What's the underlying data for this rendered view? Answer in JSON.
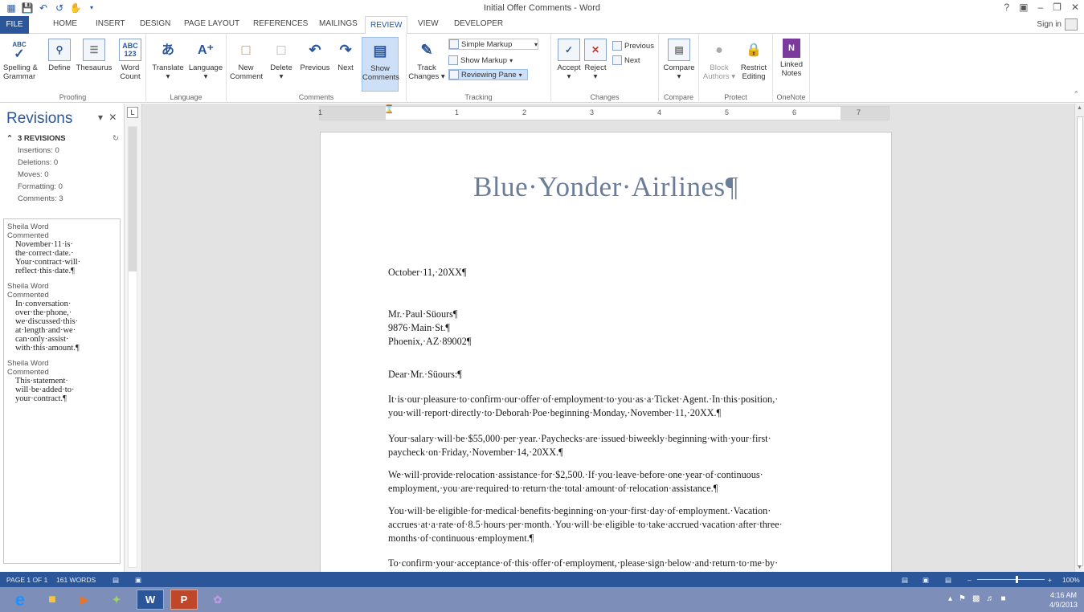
{
  "titlebar": {
    "title": "Initial Offer Comments - Word",
    "controls": [
      "?",
      "▣",
      "–",
      "❐",
      "✕"
    ]
  },
  "tabs": {
    "file": "FILE",
    "items": [
      "HOME",
      "INSERT",
      "DESIGN",
      "PAGE LAYOUT",
      "REFERENCES",
      "MAILINGS",
      "REVIEW",
      "VIEW",
      "DEVELOPER"
    ],
    "active": "REVIEW",
    "sign_in": "Sign in"
  },
  "ribbon": {
    "proofing": {
      "label": "Proofing",
      "spelling": "Spelling &",
      "spelling2": "Grammar",
      "define": "Define",
      "thesaurus": "Thesaurus",
      "wordcount": "Word",
      "wordcount2": "Count",
      "spell_icon": "ABC",
      "wc_icon": "ABC\n123"
    },
    "language": {
      "label": "Language",
      "translate": "Translate",
      "language": "Language"
    },
    "comments": {
      "label": "Comments",
      "new": "New",
      "new2": "Comment",
      "delete": "Delete",
      "previous": "Previous",
      "next": "Next",
      "show": "Show",
      "show2": "Comments"
    },
    "tracking": {
      "label": "Tracking",
      "track": "Track",
      "track2": "Changes",
      "markup_select": "Simple Markup",
      "show_markup": "Show Markup",
      "reviewing_pane": "Reviewing Pane"
    },
    "changes": {
      "label": "Changes",
      "accept": "Accept",
      "reject": "Reject",
      "previous": "Previous",
      "next": "Next"
    },
    "compare": {
      "label": "Compare",
      "compare": "Compare"
    },
    "protect": {
      "label": "Protect",
      "block": "Block",
      "block2": "Authors",
      "restrict": "Restrict",
      "restrict2": "Editing"
    },
    "onenote": {
      "label": "OneNote",
      "linked": "Linked",
      "linked2": "Notes"
    }
  },
  "revisions": {
    "title": "Revisions",
    "summary_header": "3 REVISIONS",
    "stats": [
      "Insertions: 0",
      "Deletions: 0",
      "Moves: 0",
      "Formatting: 0",
      "Comments: 3"
    ],
    "items": [
      {
        "author": "Sheila Word",
        "action": "Commented",
        "text": [
          "November·11·is·",
          "the·correct·date.·",
          "Your·contract·will·",
          "reflect·this·date.¶"
        ]
      },
      {
        "author": "Sheila Word",
        "action": "Commented",
        "text": [
          "In·conversation·",
          "over·the·phone,·",
          "we·discussed·this·",
          "at·length·and·we·",
          "can·only·assist·",
          "with·this·amount.¶"
        ]
      },
      {
        "author": "Sheila Word",
        "action": "Commented",
        "text": [
          "This·statement·",
          "will·be·added·to·",
          "your·contract.¶"
        ]
      }
    ]
  },
  "ruler": {
    "numbers": [
      "1",
      "1",
      "2",
      "3",
      "4",
      "5",
      "6",
      "7"
    ]
  },
  "document": {
    "heading": "Blue·Yonder·Airlines¶",
    "date": "October·11,·20XX¶",
    "address": [
      "Mr.·Paul·Süours¶",
      "9876·Main·St.¶",
      "Phoenix,·AZ·89002¶"
    ],
    "salutation": "Dear·Mr.·Süours:¶",
    "paragraphs": [
      [
        "It·is·our·pleasure·to·confirm·our·offer·of·employment·to·you·as·a·Ticket·Agent.·In·this·position,·",
        "you·will·report·directly·to·Deborah·Poe·beginning·Monday,·November·11,·20XX.¶"
      ],
      [
        "Your·salary·will·be·$55,000·per·year.·Paychecks·are·issued·biweekly·beginning·with·your·first·",
        "paycheck·on·Friday,·November·14,·20XX.¶"
      ],
      [
        "We·will·provide·relocation·assistance·for·$2,500.·If·you·leave·before·one·year·of·continuous·",
        "employment,·you·are·required·to·return·the·total·amount·of·relocation·assistance.¶"
      ],
      [
        "You·will·be·eligible·for·medical·benefits·beginning·on·your·first·day·of·employment.·Vacation·",
        "accrues·at·a·rate·of·8.5·hours·per·month.·You·will·be·eligible·to·take·accrued·vacation·after·three·",
        "months·of·continuous·employment.¶"
      ],
      [
        "To·confirm·your·acceptance·of·this·offer·of·employment,·please·sign·below·and·return·to·me·by·"
      ]
    ]
  },
  "status": {
    "page": "PAGE 1 OF 1",
    "words": "161 WORDS",
    "zoom": "100%"
  },
  "taskbar": {
    "time": "4:16 AM",
    "date": "4/9/2013",
    "word_label": "W",
    "ppt_label": "P"
  },
  "colors": {
    "accent": "#2b579a",
    "heading": "#6b7d98",
    "taskbar": "#7d8fb8"
  }
}
